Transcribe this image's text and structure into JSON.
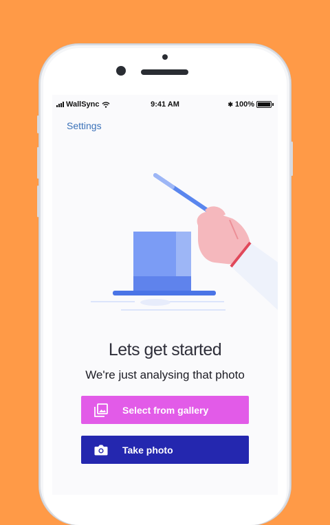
{
  "status_bar": {
    "carrier": "WallSync",
    "time": "9:41 AM",
    "battery": "100%",
    "bluetooth_glyph": "✱"
  },
  "nav": {
    "settings_label": "Settings"
  },
  "onboarding": {
    "title": "Lets get started",
    "subtitle": "We're just analysing that photo"
  },
  "actions": {
    "gallery_label": "Select from gallery",
    "gallery_icon": "gallery-icon",
    "photo_label": "Take photo",
    "photo_icon": "camera-icon"
  },
  "colors": {
    "background": "#FF9A47",
    "settings_link": "#3a71b8",
    "gallery_button": "#E25BE8",
    "photo_button": "#2427AF",
    "illustration_blue": "#6f8ef0"
  }
}
